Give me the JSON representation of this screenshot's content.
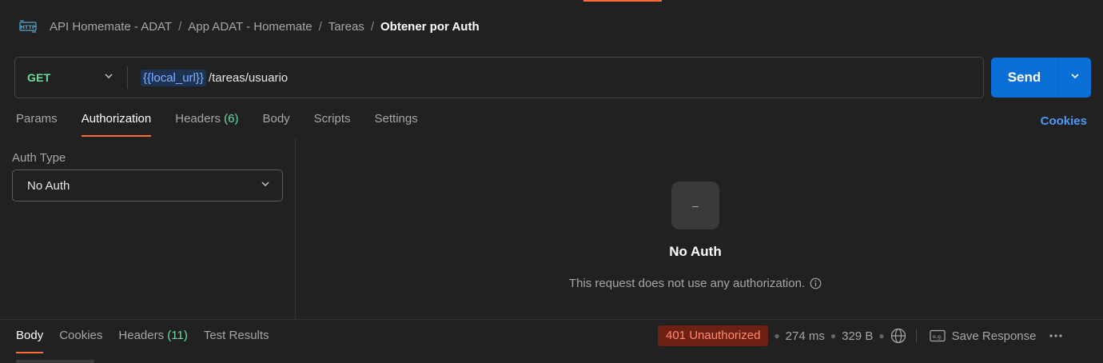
{
  "breadcrumb": {
    "items": [
      "API Homemate - ADAT",
      "App ADAT - Homemate",
      "Tareas"
    ],
    "current": "Obtener por Auth"
  },
  "request": {
    "method": "GET",
    "url_variable": "{{local_url}}",
    "url_path": "/tareas/usuario",
    "send_label": "Send"
  },
  "request_tabs": {
    "params": "Params",
    "authorization": "Authorization",
    "headers": "Headers",
    "headers_count": "(6)",
    "body": "Body",
    "scripts": "Scripts",
    "settings": "Settings",
    "cookies": "Cookies"
  },
  "auth": {
    "type_label": "Auth Type",
    "selected": "No Auth",
    "icon_glyph": "–",
    "empty_title": "No Auth",
    "empty_desc": "This request does not use any authorization."
  },
  "response": {
    "tabs": {
      "body": "Body",
      "cookies": "Cookies",
      "headers": "Headers",
      "headers_count": "(11)",
      "test_results": "Test Results"
    },
    "status": "401 Unauthorized",
    "time": "274 ms",
    "size": "329 B",
    "save_label": "Save Response"
  },
  "colors": {
    "accent": "#ff6c37",
    "method_get": "#6bdd9a",
    "send": "#0b6fd8",
    "link": "#4e9bf8",
    "status_error_bg": "#6e2113",
    "status_error_text": "#ff8a70"
  }
}
